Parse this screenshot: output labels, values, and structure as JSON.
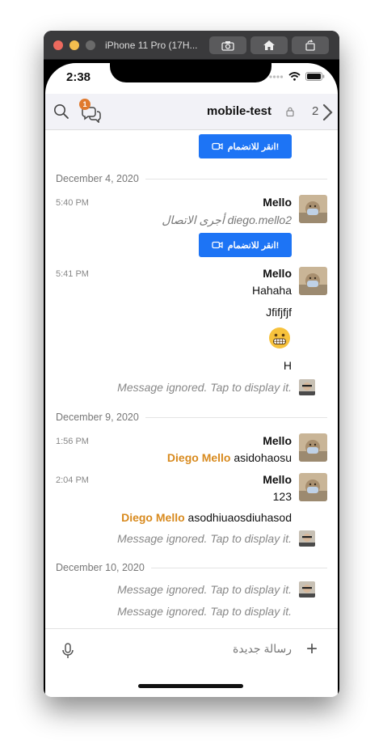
{
  "window": {
    "title": "iPhone 11 Pro (17H..."
  },
  "status_bar": {
    "time": "2:38"
  },
  "header": {
    "room_name": "mobile-test",
    "badge_count": "1",
    "unread_count": "2"
  },
  "messages": {
    "join_label": "انقر للانضمام!",
    "dates": [
      "December 4, 2020",
      "December 9, 2020",
      "December 10, 2020"
    ],
    "group1": {
      "time": "5:40 PM",
      "user": "Mello",
      "system_text": "أجرى الاتصال diego.mello2"
    },
    "group2": {
      "time": "5:41 PM",
      "user": "Mello",
      "lines": [
        "Hahaha",
        "Jfifjfjf",
        "H"
      ]
    },
    "ignored": "Message ignored. Tap to display it.",
    "group3": {
      "time": "1:56 PM",
      "user": "Mello",
      "mention": "Diego Mello",
      "text": "asidohaosu"
    },
    "group4": {
      "time": "2:04 PM",
      "user": "Mello",
      "text": "123",
      "mention": "Diego Mello",
      "text2": "asodhiuaosdiuhasod"
    }
  },
  "composer": {
    "placeholder": "رسالة جديدة",
    "plus": "+"
  },
  "colors": {
    "accent_blue": "#1d74f5",
    "mention_orange": "#d88a1e",
    "badge_orange": "#e07a2e"
  },
  "icons": [
    "search-icon",
    "discussion-icon",
    "lock-icon",
    "chevron-right-icon",
    "mic-icon",
    "plus-icon",
    "camera-icon",
    "home-icon",
    "rotate-icon",
    "video-call-icon"
  ]
}
